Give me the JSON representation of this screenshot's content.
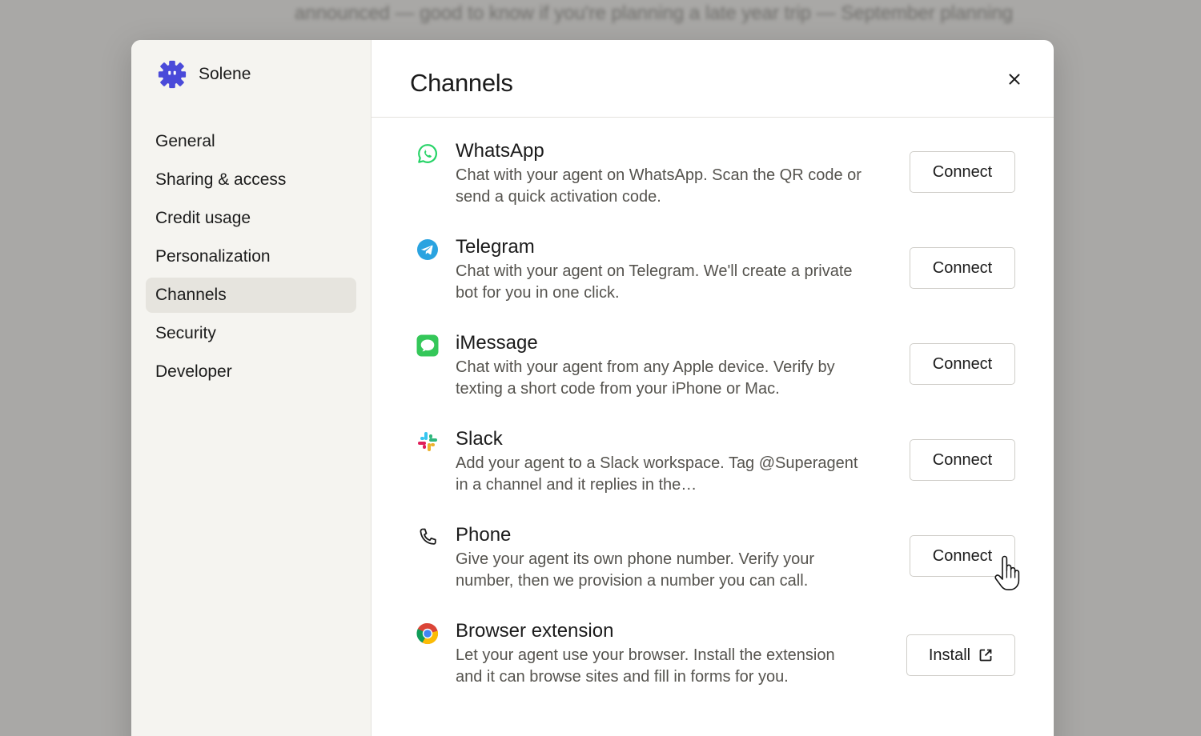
{
  "background": {
    "text": "announced — good to know if you're planning a late year trip — September planning"
  },
  "brand": {
    "name": "Solene",
    "logo_icon": "gear-icon",
    "accent": "#4a4ad9"
  },
  "sidebar": {
    "items": [
      {
        "label": "General"
      },
      {
        "label": "Sharing & access"
      },
      {
        "label": "Credit usage"
      },
      {
        "label": "Personalization"
      },
      {
        "label": "Channels",
        "active": true
      },
      {
        "label": "Security"
      },
      {
        "label": "Developer"
      }
    ]
  },
  "main": {
    "title": "Channels",
    "close_icon": "close-icon"
  },
  "channels": [
    {
      "name": "WhatsApp",
      "description": "Chat with your agent on WhatsApp. Scan the QR code or send a quick activation code.",
      "button": "Connect",
      "icon": "whatsapp-icon",
      "color": "#25d366"
    },
    {
      "name": "Telegram",
      "description": "Chat with your agent on Telegram. We'll create a private bot for you in one click.",
      "button": "Connect",
      "icon": "telegram-icon",
      "color": "#2aa3e0"
    },
    {
      "name": "iMessage",
      "description": "Chat with your agent from any Apple device. Verify by texting a short code from your iPhone or Mac.",
      "button": "Connect",
      "icon": "imessage-icon",
      "color": "#34c759"
    },
    {
      "name": "Slack",
      "description": "Add your agent to a Slack workspace. Tag @Superagent in a channel and it replies in the…",
      "button": "Connect",
      "icon": "slack-icon",
      "color": "#e01e5a"
    },
    {
      "name": "Phone",
      "description": "Give your agent its own phone number. Verify your number, then we provision a number you can call.",
      "button": "Connect",
      "icon": "phone-icon",
      "color": "#1b1b1b"
    },
    {
      "name": "Browser extension",
      "description": "Let your agent use your browser. Install the extension and it can browse sites and fill in forms for you.",
      "button": "Install",
      "icon": "chrome-icon",
      "button_icon": "external-link-icon",
      "color": "#4285f4"
    }
  ]
}
